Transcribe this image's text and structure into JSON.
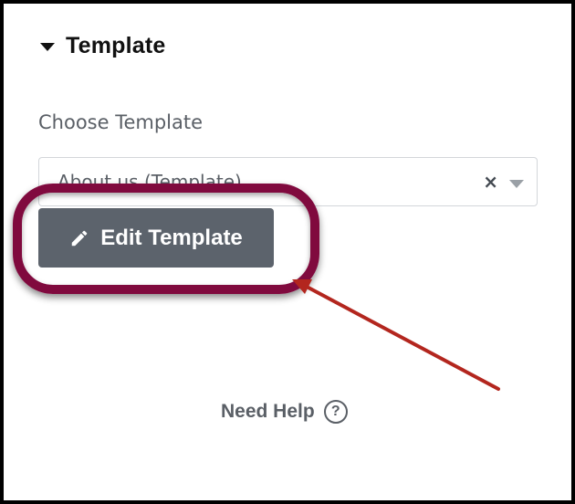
{
  "panel": {
    "section_title": "Template",
    "section_caret_icon": "caret-down-icon"
  },
  "template_field": {
    "label": "Choose Template",
    "selected_value": "About us (Template)",
    "clear_symbol": "×",
    "dropdown_icon": "chevron-down-icon"
  },
  "edit_button": {
    "label": "Edit Template",
    "icon": "pencil-icon",
    "background_color": "#5c636c"
  },
  "annotation": {
    "highlight_color": "#800a3e",
    "arrow_color": "#b3261e"
  },
  "help": {
    "label": "Need Help",
    "icon": "question-circle-icon",
    "icon_glyph": "?"
  }
}
